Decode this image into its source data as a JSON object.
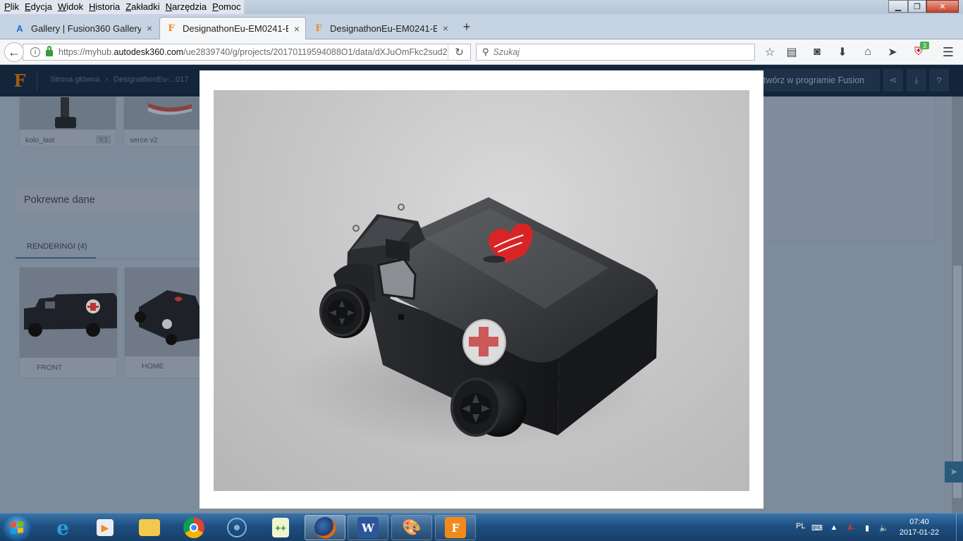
{
  "browser": {
    "menu": [
      "Plik",
      "Edycja",
      "Widok",
      "Historia",
      "Zakładki",
      "Narzędzia",
      "Pomoc"
    ],
    "tabs": [
      {
        "title": "Gallery | Fusion360 Gallery",
        "icon": "autodesk-gallery-icon",
        "active": false
      },
      {
        "title": "DesignathonEu-EM0241-E...",
        "icon": "fusion-icon",
        "active": true
      },
      {
        "title": "DesignathonEu-EM0241-E...",
        "icon": "fusion-icon",
        "active": false
      }
    ],
    "url_prefix": "https://myhub.",
    "url_domain": "autodesk360.com",
    "url_path": "/ue2839740/g/projects/20170119594088O1/data/dXJuOmFkc2sud2",
    "search_placeholder": "Szukaj",
    "addon_badge": "3"
  },
  "app": {
    "breadcrumb": [
      "Strona główna",
      "›",
      "DesignathonEu-...017"
    ],
    "open_in_fusion": "twórz w programie Fusion",
    "related_title": "Pokrewne dane",
    "renderings_tab": "RENDERINGI (4)",
    "files": [
      {
        "name": "kolo_last",
        "version": "V.1"
      },
      {
        "name": "serce v2",
        "version": ""
      }
    ],
    "renderings": [
      {
        "label": "FRONT"
      },
      {
        "label": "HOME"
      }
    ]
  },
  "modal": {
    "image_subject": "dark toy ambulance car rendering with red cross and red heart sticker"
  },
  "taskbar": {
    "language": "PL",
    "time": "07:40",
    "date": "2017-01-22",
    "apps": [
      "internet-explorer",
      "media-player",
      "file-explorer",
      "chrome",
      "app-circle",
      "notepad-plus",
      "firefox",
      "word",
      "paint",
      "fusion360"
    ]
  },
  "colors": {
    "accent_fusion": "#f08a1c",
    "app_header": "#13253a",
    "taskbar": "#1e4f80"
  }
}
